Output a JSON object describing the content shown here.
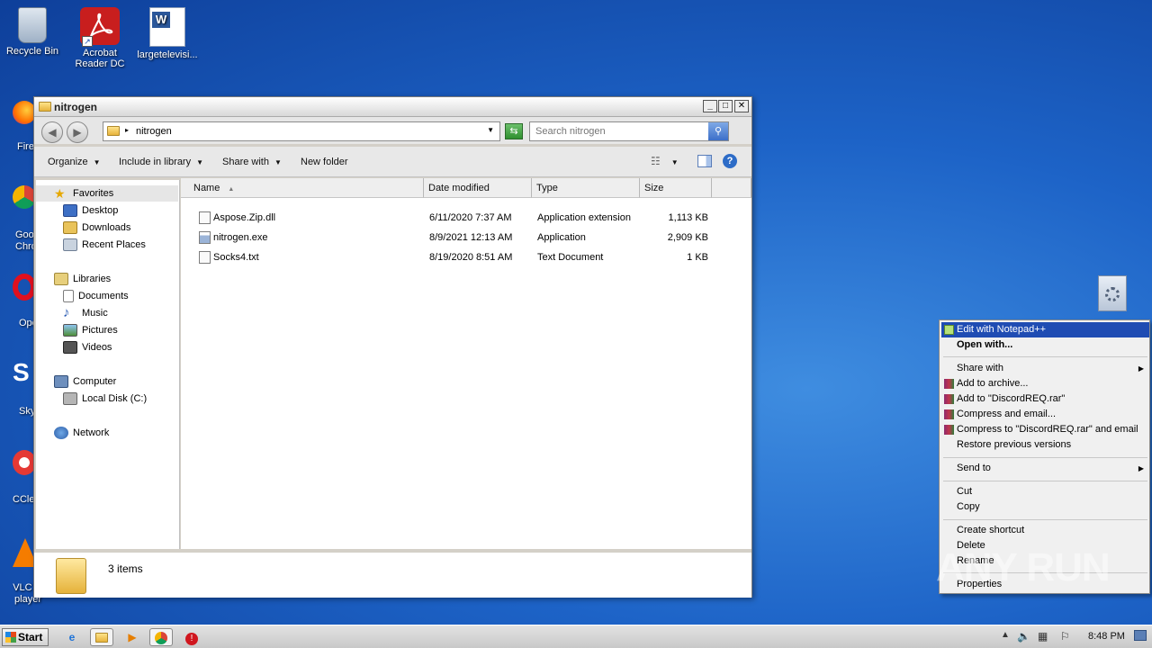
{
  "desktop": {
    "icons": [
      {
        "label": "Recycle Bin",
        "icon": "recycle-bin-icon"
      },
      {
        "label": "Acrobat Reader DC",
        "icon": "acrobat-icon"
      },
      {
        "label": "largetelevisi...",
        "icon": "word-document-icon"
      }
    ],
    "partial_labels": [
      "Fire",
      "Goo Chro",
      "Ope",
      "Sky",
      "CCle",
      "VLC m player"
    ]
  },
  "window": {
    "title": "nitrogen",
    "address": "nitrogen",
    "search_placeholder": "Search nitrogen",
    "toolbar": {
      "organize": "Organize",
      "include_in_library": "Include in library",
      "share_with": "Share with",
      "new_folder": "New folder"
    },
    "nav": {
      "favorites": "Favorites",
      "desktop": "Desktop",
      "downloads": "Downloads",
      "recent_places": "Recent Places",
      "libraries": "Libraries",
      "documents": "Documents",
      "music": "Music",
      "pictures": "Pictures",
      "videos": "Videos",
      "computer": "Computer",
      "local_disk": "Local Disk (C:)",
      "network": "Network"
    },
    "columns": {
      "name": "Name",
      "date": "Date modified",
      "type": "Type",
      "size": "Size"
    },
    "files": [
      {
        "name": "Aspose.Zip.dll",
        "date": "6/11/2020 7:37 AM",
        "type": "Application extension",
        "size": "1,113 KB"
      },
      {
        "name": "nitrogen.exe",
        "date": "8/9/2021 12:13 AM",
        "type": "Application",
        "size": "2,909 KB"
      },
      {
        "name": "Socks4.txt",
        "date": "8/19/2020 8:51 AM",
        "type": "Text Document",
        "size": "1 KB"
      }
    ],
    "status": "3 items"
  },
  "context_menu": {
    "edit_notepad": "Edit with Notepad++",
    "open_with": "Open with...",
    "share_with": "Share with",
    "add_archive": "Add to archive...",
    "add_rar": "Add to \"DiscordREQ.rar\"",
    "compress_email": "Compress and email...",
    "compress_rar_email": "Compress to \"DiscordREQ.rar\" and email",
    "restore": "Restore previous versions",
    "send_to": "Send to",
    "cut": "Cut",
    "copy": "Copy",
    "create_shortcut": "Create shortcut",
    "delete": "Delete",
    "rename": "Rename",
    "properties": "Properties"
  },
  "watermark": "ANY RUN",
  "taskbar": {
    "start": "Start",
    "clock": "8:48 PM"
  },
  "colors": {
    "menu_highlight": "#1f4cb3",
    "desktop": "#1d63c7"
  }
}
